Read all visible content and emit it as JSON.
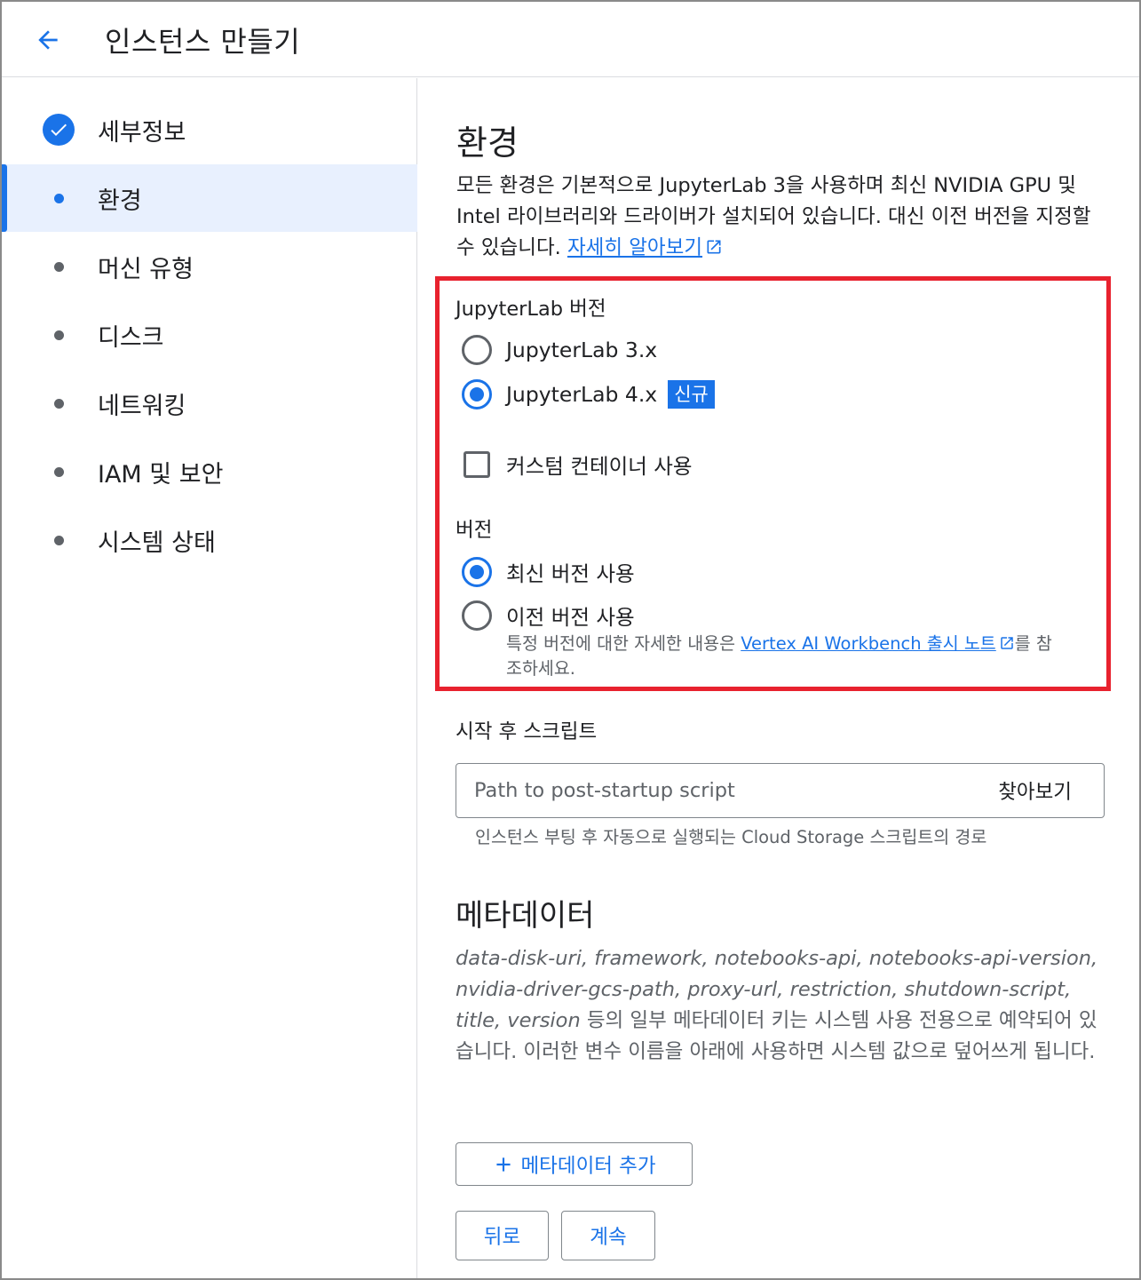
{
  "header": {
    "title": "인스턴스 만들기",
    "back_icon": "arrow-back-icon"
  },
  "sidebar": {
    "items": [
      {
        "label": "세부정보",
        "state": "completed"
      },
      {
        "label": "환경",
        "state": "active"
      },
      {
        "label": "머신 유형",
        "state": "pending"
      },
      {
        "label": "디스크",
        "state": "pending"
      },
      {
        "label": "네트워킹",
        "state": "pending"
      },
      {
        "label": "IAM 및 보안",
        "state": "pending"
      },
      {
        "label": "시스템 상태",
        "state": "pending"
      }
    ]
  },
  "main": {
    "title": "환경",
    "description": "모든 환경은 기본적으로 JupyterLab 3을 사용하며 최신 NVIDIA GPU 및 Intel 라이브러리와 드라이버가 설치되어 있습니다. 대신 이전 버전을 지정할 수 있습니다.",
    "learn_more": "자세히 알아보기",
    "jupyterlab": {
      "label": "JupyterLab 버전",
      "options": [
        {
          "label": "JupyterLab 3.x",
          "selected": false
        },
        {
          "label": "JupyterLab 4.x",
          "selected": true,
          "badge": "신규"
        }
      ]
    },
    "custom_container": {
      "label": "커스텀 컨테이너 사용",
      "checked": false
    },
    "version": {
      "label": "버전",
      "options": [
        {
          "label": "최신 버전 사용",
          "selected": true
        },
        {
          "label": "이전 버전 사용",
          "selected": false
        }
      ],
      "hint_prefix": "특정 버전에 대한 자세한 내용은 ",
      "hint_link": "Vertex AI Workbench 출시 노트",
      "hint_suffix_1": "를 참",
      "hint_suffix_2": "조하세요."
    },
    "post_startup": {
      "label": "시작 후 스크립트",
      "placeholder": "Path to post-startup script",
      "value": "",
      "browse": "찾아보기",
      "hint": "인스턴스 부팅 후 자동으로 실행되는 Cloud Storage 스크립트의 경로"
    },
    "metadata": {
      "title": "메타데이터",
      "reserved_keys": "data-disk-uri, framework, notebooks-api, notebooks-api-version, nvidia-driver-gcs-path, proxy-url, restriction, shutdown-script, title, version",
      "reserved_note": " 등의 일부 메타데이터 키는 시스템 사용 전용으로 예약되어 있습니다. 이러한 변수 이름을 아래에 사용하면 시스템 값으로 덮어쓰게 됩니다.",
      "add_button": "메타데이터 추가"
    },
    "buttons": {
      "back": "뒤로",
      "continue": "계속"
    }
  },
  "colors": {
    "accent": "#1a73e8",
    "highlight": "#e8222e",
    "active_bg": "#e8f0fe"
  }
}
